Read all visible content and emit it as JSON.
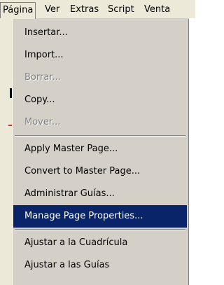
{
  "menubar": {
    "items": [
      {
        "label": "Página",
        "key": "P"
      },
      {
        "label": "Ver",
        "key": "V"
      },
      {
        "label": "Extras",
        "key": "x"
      },
      {
        "label": "Script",
        "key": "S"
      },
      {
        "label": "Venta",
        "key": "V"
      }
    ]
  },
  "menu": {
    "items": [
      {
        "label": "Insertar...",
        "disabled": false
      },
      {
        "label": "Import...",
        "disabled": false
      },
      {
        "label": "Borrar...",
        "disabled": true
      },
      {
        "label": "Copy...",
        "disabled": false
      },
      {
        "label": "Mover...",
        "disabled": true
      },
      {
        "label": "Apply Master Page...",
        "disabled": false
      },
      {
        "label": "Convert to Master Page...",
        "disabled": false
      },
      {
        "label": "Administrar Guías...",
        "disabled": false
      },
      {
        "label": "Manage Page Properties...",
        "disabled": false,
        "highlighted": true
      },
      {
        "label": "Ajustar a la Cuadrícula",
        "disabled": false
      },
      {
        "label": "Ajustar a las Guías",
        "disabled": false
      }
    ]
  },
  "colors": {
    "menu_bg": "#d4d0c8",
    "highlight_bg": "#0a246a",
    "highlight_text": "#ffffff",
    "disabled_text": "#808080"
  }
}
